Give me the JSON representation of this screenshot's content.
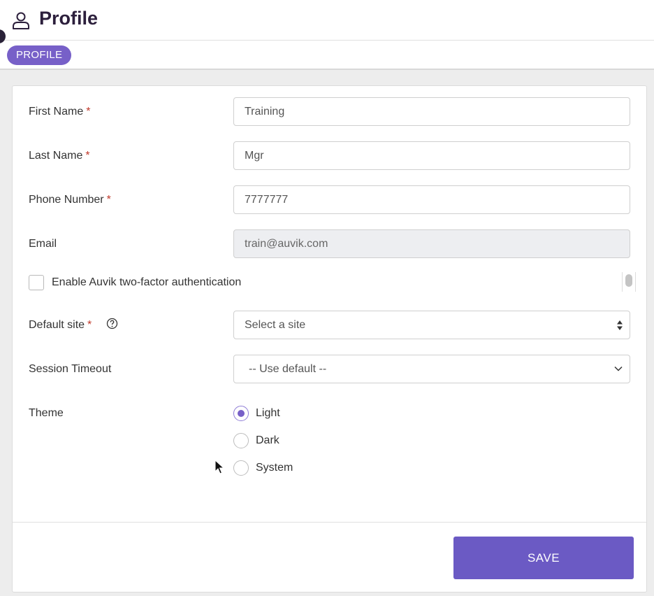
{
  "header": {
    "title": "Profile",
    "icon": "user-icon"
  },
  "tabs": [
    {
      "label": "PROFILE",
      "active": true
    }
  ],
  "form": {
    "first_name": {
      "label": "First Name",
      "required_mark": "*",
      "value": "Training"
    },
    "last_name": {
      "label": "Last Name",
      "required_mark": "*",
      "value": "Mgr"
    },
    "phone": {
      "label": "Phone Number",
      "required_mark": "*",
      "value": "7777777"
    },
    "email": {
      "label": "Email",
      "value": "train@auvik.com",
      "disabled": true
    },
    "two_factor": {
      "label": "Enable Auvik two-factor authentication",
      "checked": false
    },
    "default_site": {
      "label": "Default site",
      "required_mark": "*",
      "value": "Select a site",
      "help_icon": "question-circle-icon"
    },
    "session_timeout": {
      "label": "Session Timeout",
      "value": "-- Use default --"
    },
    "theme": {
      "label": "Theme",
      "selected": "Light",
      "options": [
        {
          "label": "Light"
        },
        {
          "label": "Dark"
        },
        {
          "label": "System"
        }
      ]
    }
  },
  "actions": {
    "save_label": "SAVE"
  },
  "colors": {
    "accent": "#7760c8",
    "button": "#6b5ac4",
    "required": "#c0392b",
    "title": "#2c1f3c"
  }
}
